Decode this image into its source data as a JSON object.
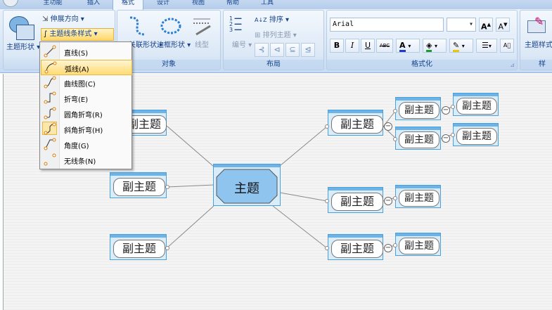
{
  "tabs": [
    "主功能",
    "插入",
    "格式",
    "设计",
    "视图",
    "帮助",
    "工具"
  ],
  "ribbon": {
    "shape_btn": "主题形状",
    "grow_dir": "伸展方向",
    "line_style": "主题线条样式",
    "rel_shape": "关联形状",
    "border_shape": "边框形状",
    "line_type": "线型",
    "sort": "排序",
    "arrange": "排列主题",
    "number": "编号",
    "font": "Arial",
    "bold": "B",
    "italic": "I",
    "underline": "U",
    "strike": "ABC",
    "font_color": "A",
    "theme_style": "主题样式",
    "groups": {
      "object": "对象",
      "layout": "布局",
      "format": "格式化",
      "style": "样"
    }
  },
  "menu": {
    "items": [
      "直线(S)",
      "弧线(A)",
      "曲线图(C)",
      "折弯(E)",
      "圆角折弯(R)",
      "斜角折弯(H)",
      "角度(G)",
      "无线条(N)"
    ],
    "selected": 1
  },
  "map": {
    "central": "主题",
    "subtopic": "副主题"
  }
}
